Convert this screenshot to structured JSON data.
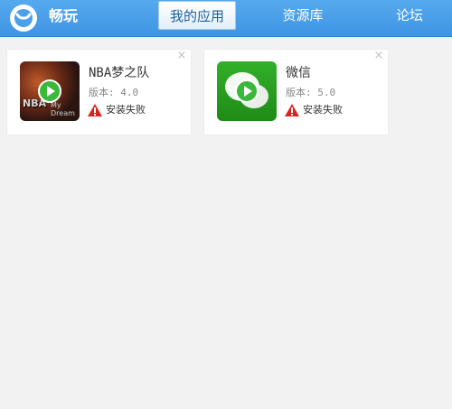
{
  "header": {
    "app_name": "畅玩",
    "tabs": [
      {
        "label": "我的应用",
        "active": true
      },
      {
        "label": "资源库",
        "active": false
      },
      {
        "label": "论坛",
        "active": false
      }
    ],
    "colors": {
      "bar": "#4aa0ea",
      "active_tab_text": "#1e5f9c"
    }
  },
  "apps": [
    {
      "name": "NBA梦之队",
      "version": "版本: 4.0",
      "status": "安装失败",
      "icon": "nba-game-icon",
      "close": "×"
    },
    {
      "name": "微信",
      "version": "版本: 5.0",
      "status": "安装失败",
      "icon": "wechat-icon",
      "close": "×"
    }
  ],
  "icon_art": {
    "nba_logo_text": "NBA",
    "nba_sub_text": "My Dream"
  }
}
